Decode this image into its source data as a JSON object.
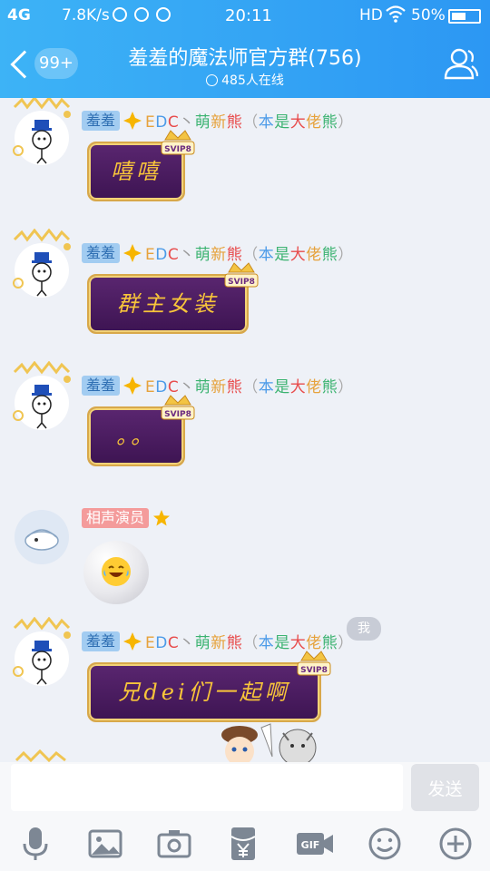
{
  "status_bar": {
    "network": "4G",
    "speed": "7.8K/s",
    "time": "20:11",
    "hd": "HD",
    "battery": "50%"
  },
  "header": {
    "back_badge": "99+",
    "title": "羞羞的魔法师官方群(756)",
    "online": "485人在线"
  },
  "messages": [
    {
      "tag": "羞羞",
      "nick_parts": [
        "E",
        "D",
        "C",
        "丶",
        "萌",
        "新",
        "熊",
        "（",
        "本",
        "是",
        "大",
        "佬",
        "熊",
        "）"
      ],
      "bubble_text": "嘻嘻"
    },
    {
      "tag": "羞羞",
      "nick_parts": [
        "E",
        "D",
        "C",
        "丶",
        "萌",
        "新",
        "熊",
        "（",
        "本",
        "是",
        "大",
        "佬",
        "熊",
        "）"
      ],
      "bubble_text": "群主女装"
    },
    {
      "tag": "羞羞",
      "nick_parts": [
        "E",
        "D",
        "C",
        "丶",
        "萌",
        "新",
        "熊",
        "（",
        "本",
        "是",
        "大",
        "佬",
        "熊",
        "）"
      ],
      "bubble_text": "。。"
    },
    {
      "tag": "相声演员",
      "emoji": "laughing-tears"
    },
    {
      "tag": "羞羞",
      "nick_parts": [
        "E",
        "D",
        "C",
        "丶",
        "萌",
        "新",
        "熊",
        "（",
        "本",
        "是",
        "大",
        "佬",
        "熊",
        "）"
      ],
      "bubble_text": "兄dei们一起啊"
    }
  ],
  "nick_colors": [
    "#e6a23c",
    "#4c9be8",
    "#e84c4c",
    "#999999",
    "#3cb371",
    "#e6a23c",
    "#e84c4c",
    "#aaaaaa",
    "#4c9be8",
    "#3cb371",
    "#e84c4c",
    "#e6a23c",
    "#3cb371",
    "#aaaaaa"
  ],
  "svip_label": "SVIP8",
  "me_label": "我",
  "input": {
    "placeholder": "",
    "value": ""
  },
  "send_label": "发送",
  "toolbar": [
    "mic-icon",
    "image-icon",
    "camera-icon",
    "red-packet-icon",
    "gif-icon",
    "emoji-icon",
    "plus-icon"
  ],
  "colors": {
    "header": "#2c97f3",
    "bubble": "#4a1b60",
    "bubble_text": "#f8c53a"
  }
}
